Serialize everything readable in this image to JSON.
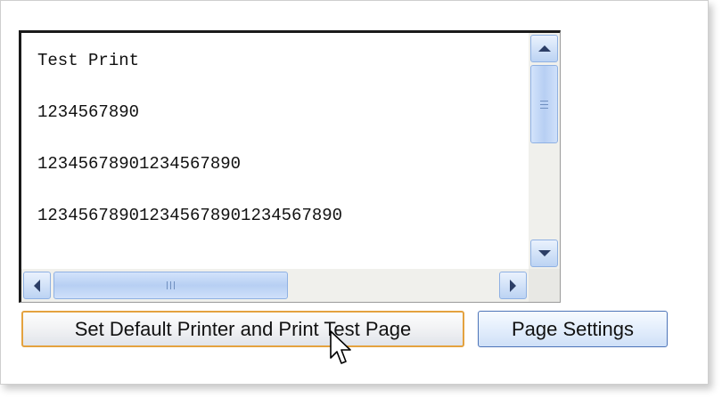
{
  "textbox": {
    "lines": [
      "Test Print",
      "1234567890",
      "12345678901234567890",
      "123456789012345678901234567890"
    ],
    "vertical_scroll_fraction": 0.0,
    "horizontal_scroll_fraction": 0.0
  },
  "buttons": {
    "print_label": "Set Default Printer and Print Test Page",
    "settings_label": "Page Settings"
  },
  "icons": {
    "scroll_up": "scroll-up-arrow-icon",
    "scroll_down": "scroll-down-arrow-icon",
    "scroll_left": "scroll-left-arrow-icon",
    "scroll_right": "scroll-right-arrow-icon",
    "cursor": "mouse-pointer-icon"
  },
  "colors": {
    "focus_border": "#e4a23f",
    "button_border": "#4d74b8",
    "scrollbar_blue": "#b7cff3"
  }
}
